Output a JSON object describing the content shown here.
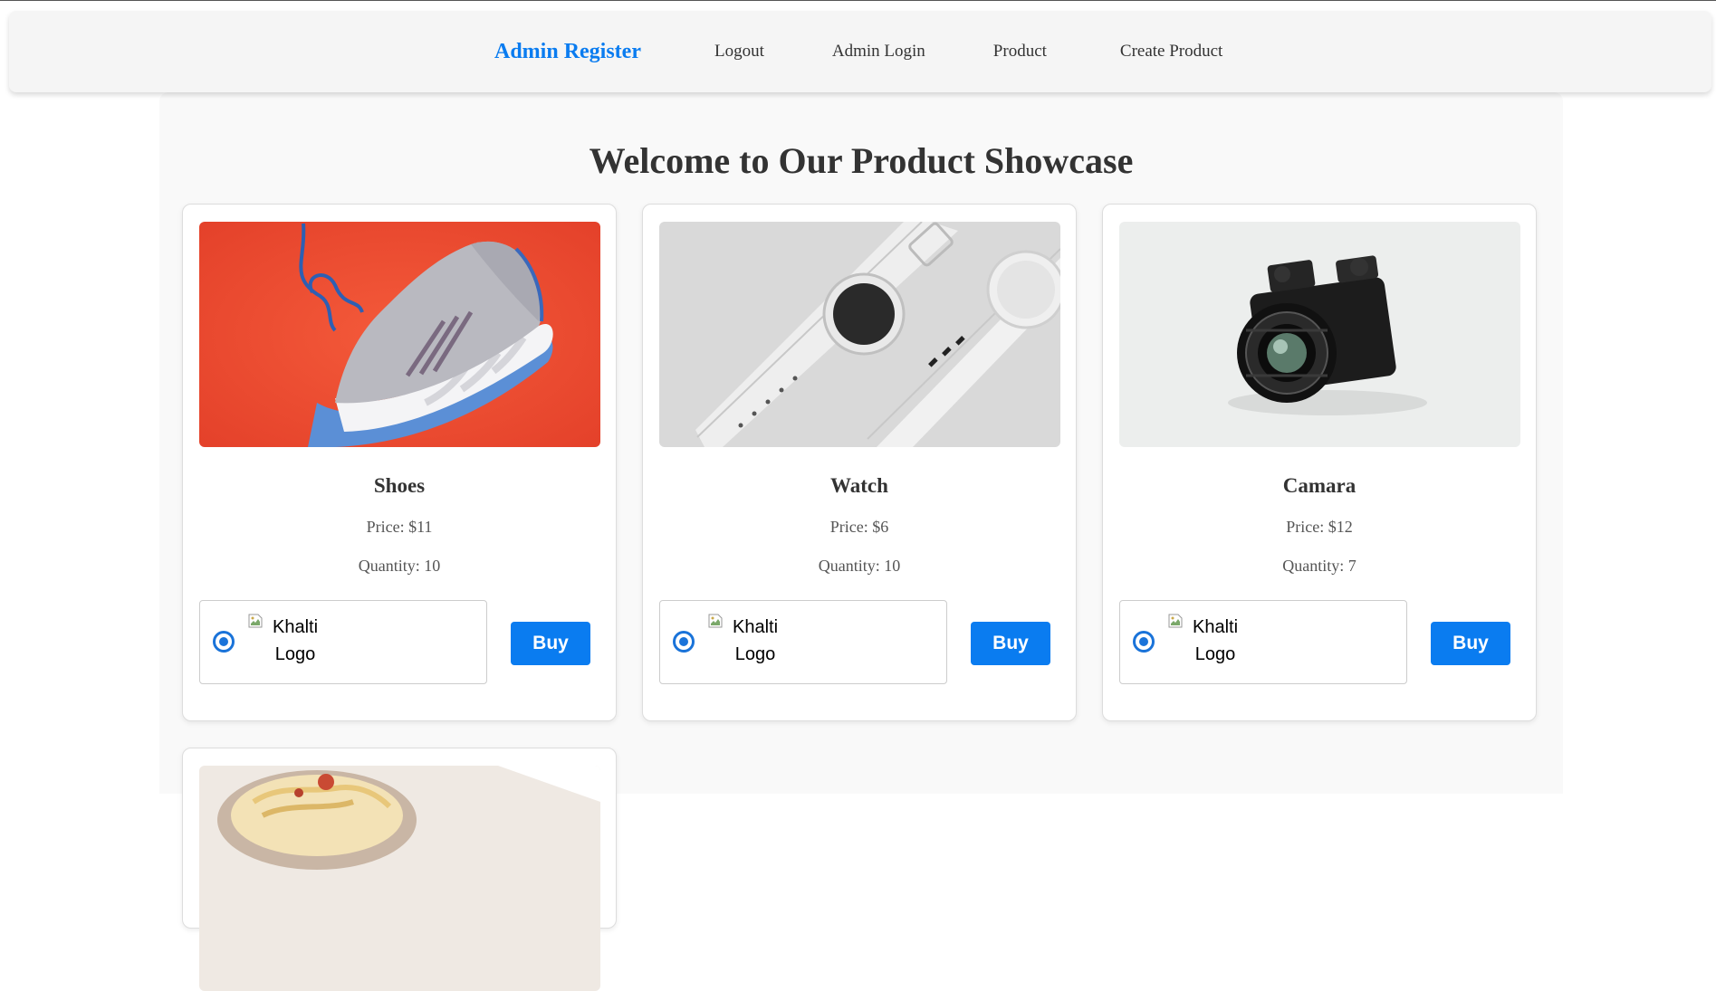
{
  "nav": {
    "brand": "Admin Register",
    "links": [
      "Logout",
      "Admin Login",
      "Product",
      "Create Product"
    ]
  },
  "main": {
    "title": "Welcome to Our Product Showcase"
  },
  "products": [
    {
      "name": "Shoes",
      "price": "Price: $11",
      "quantity": "Quantity: 10",
      "logo_alt_1": "Khalti",
      "logo_alt_2": "Logo",
      "buy_label": "Buy"
    },
    {
      "name": "Watch",
      "price": "Price: $6",
      "quantity": "Quantity: 10",
      "logo_alt_1": "Khalti",
      "logo_alt_2": "Logo",
      "buy_label": "Buy"
    },
    {
      "name": "Camara",
      "price": "Price: $12",
      "quantity": "Quantity: 7",
      "logo_alt_1": "Khalti",
      "logo_alt_2": "Logo",
      "buy_label": "Buy"
    }
  ],
  "colors": {
    "accent": "#0a7cf0",
    "radio": "#1a73d9"
  }
}
